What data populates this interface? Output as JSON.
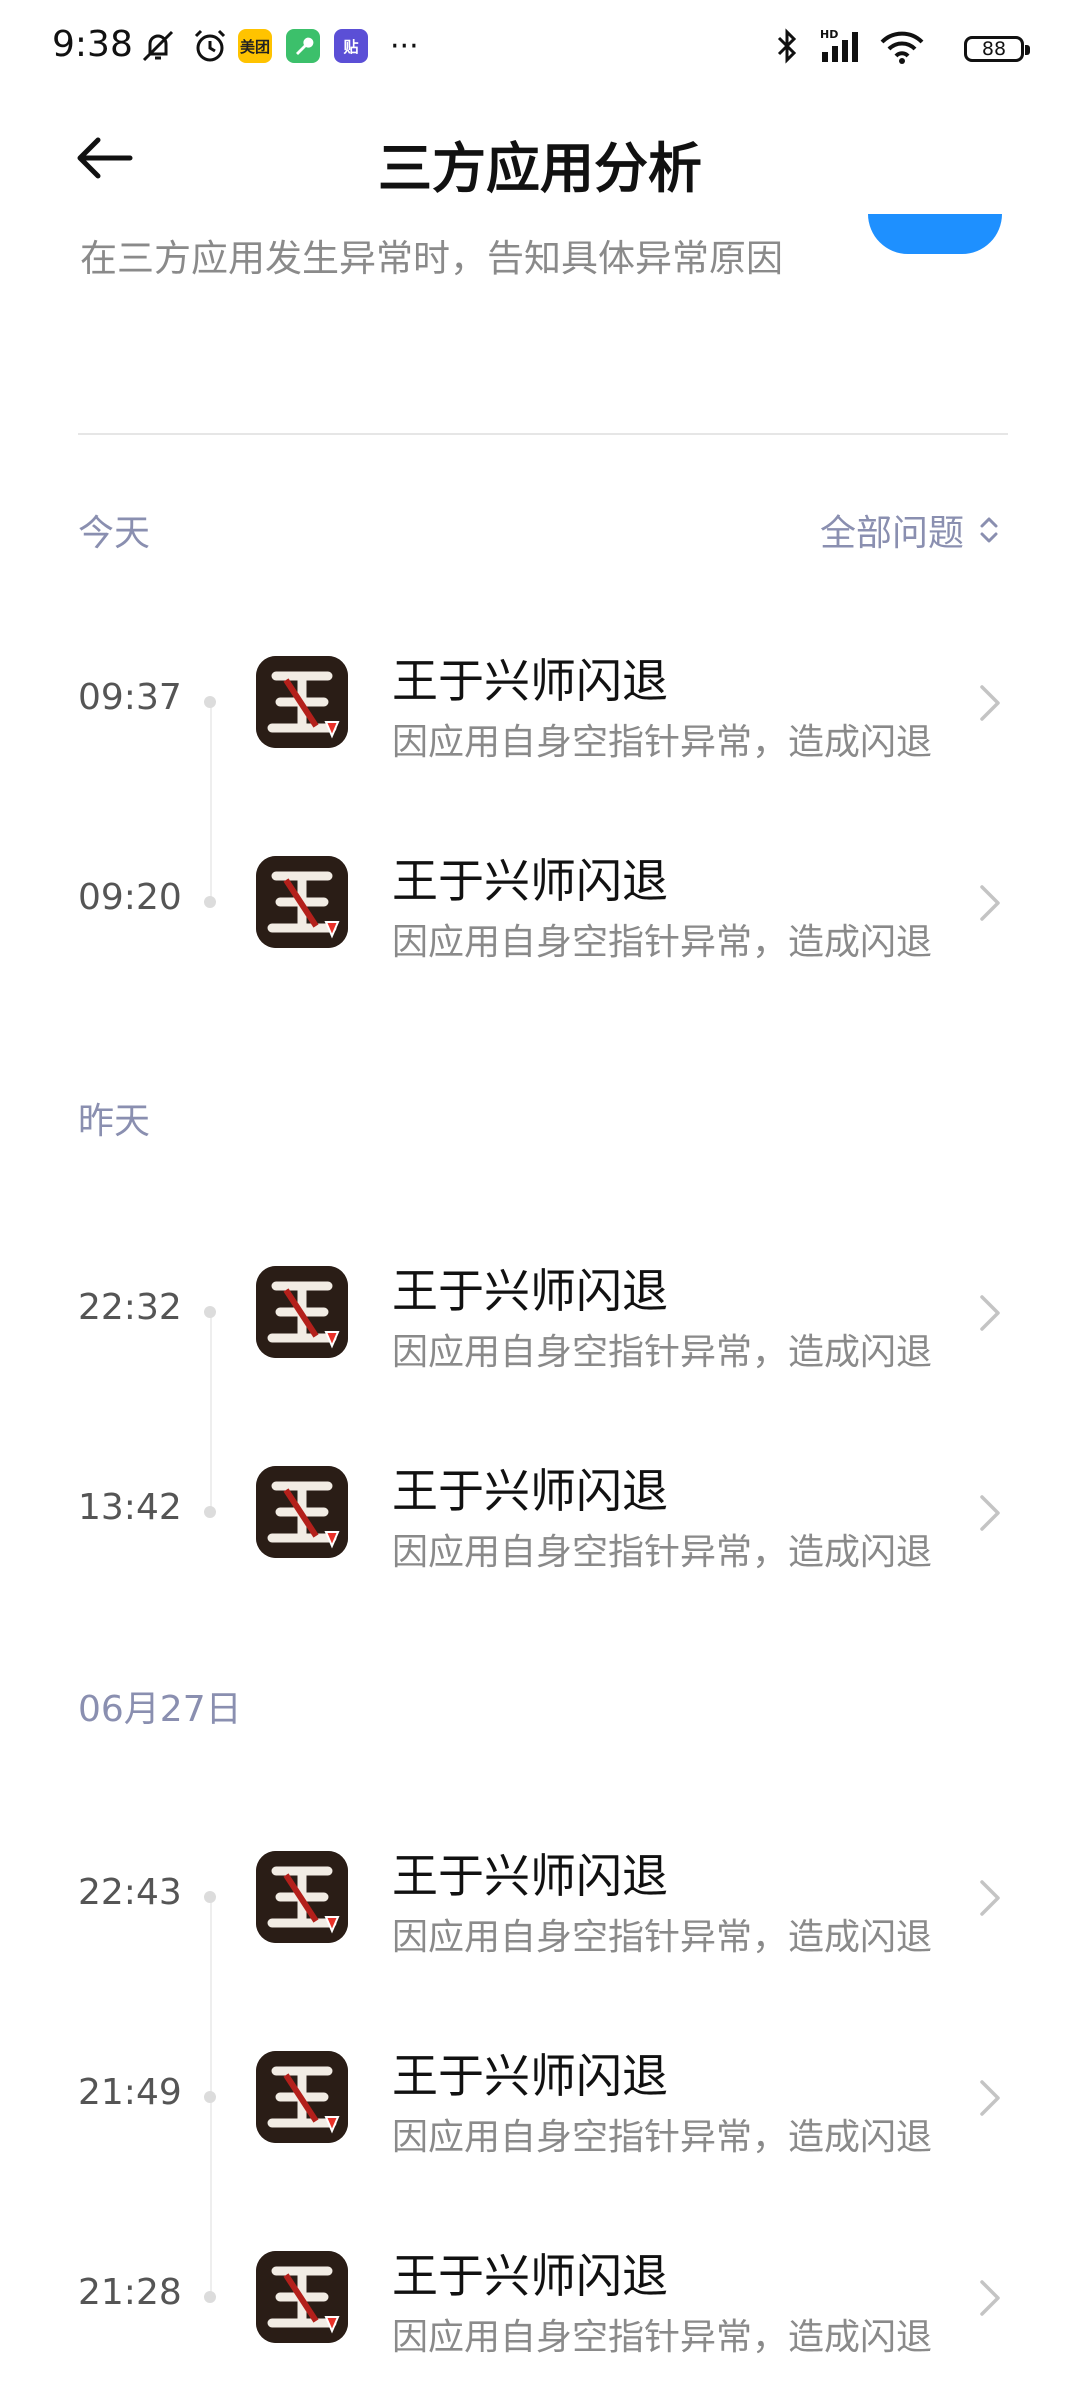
{
  "status_bar": {
    "time": "9:38",
    "app_badges": [
      {
        "name": "meituan",
        "text": "美团",
        "color": "#ffc300"
      },
      {
        "name": "wrench-app",
        "text": "🔧",
        "color": "#3cc06b"
      },
      {
        "name": "tieba",
        "text": "贴",
        "color": "#5b4fd6"
      }
    ],
    "more": "···",
    "network": "HD",
    "battery": "88"
  },
  "header": {
    "title": "三方应用分析"
  },
  "intro": {
    "subtitle": "在三方应用发生异常时，告知具体异常原因"
  },
  "filter": {
    "label": "全部问题"
  },
  "sections": [
    {
      "label": "今天",
      "items": [
        {
          "time": "09:37",
          "title": "王于兴师闪退",
          "desc": "因应用自身空指针异常，造成闪退"
        },
        {
          "time": "09:20",
          "title": "王于兴师闪退",
          "desc": "因应用自身空指针异常，造成闪退"
        }
      ]
    },
    {
      "label": "昨天",
      "items": [
        {
          "time": "22:32",
          "title": "王于兴师闪退",
          "desc": "因应用自身空指针异常，造成闪退"
        },
        {
          "time": "13:42",
          "title": "王于兴师闪退",
          "desc": "因应用自身空指针异常，造成闪退"
        }
      ]
    },
    {
      "label": "06月27日",
      "items": [
        {
          "time": "22:43",
          "title": "王于兴师闪退",
          "desc": "因应用自身空指针异常，造成闪退"
        },
        {
          "time": "21:49",
          "title": "王于兴师闪退",
          "desc": "因应用自身空指针异常，造成闪退"
        },
        {
          "time": "21:28",
          "title": "王于兴师闪退",
          "desc": "因应用自身空指针异常，造成闪退"
        }
      ]
    }
  ]
}
